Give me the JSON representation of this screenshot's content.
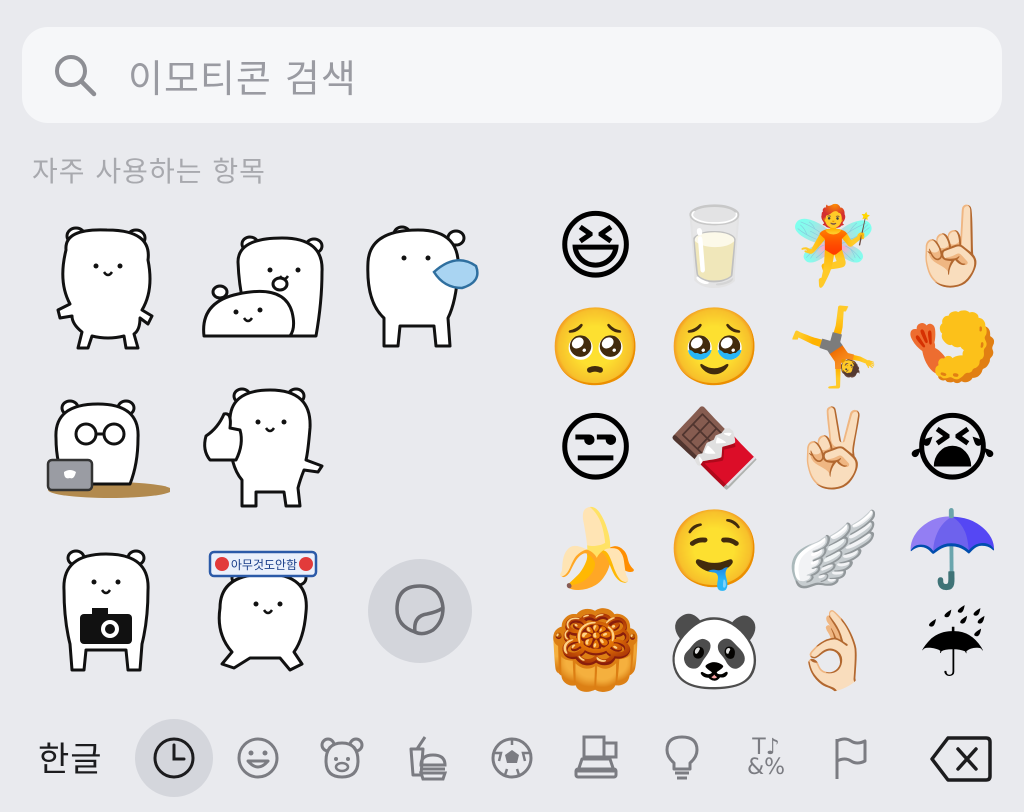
{
  "search": {
    "placeholder": "이모티콘 검색",
    "icon": "search-icon"
  },
  "section": {
    "title": "자주 사용하는 항목"
  },
  "stickers": [
    {
      "name": "bear-dancing"
    },
    {
      "name": "two-bears"
    },
    {
      "name": "bear-drinking-water"
    },
    {
      "name": "bear-with-glasses-laptop"
    },
    {
      "name": "bear-thumbs-up"
    },
    {
      "name": "bear-with-camera"
    },
    {
      "name": "bear-with-banner",
      "banner_text": "아무것도안함"
    }
  ],
  "sticker_toggle": {
    "icon": "sticker-peel-icon"
  },
  "emojis": [
    {
      "name": "grinning-squinting-face",
      "char": "😆"
    },
    {
      "name": "glass-of-milk",
      "char": "🥛"
    },
    {
      "name": "fairy",
      "char": "🧚"
    },
    {
      "name": "index-pointing-up",
      "char": "☝🏻"
    },
    {
      "name": "pleading-face",
      "char": "🥺"
    },
    {
      "name": "face-holding-back-tears",
      "char": "🥹"
    },
    {
      "name": "person-cartwheeling",
      "char": "🤸"
    },
    {
      "name": "fried-shrimp",
      "char": "🍤"
    },
    {
      "name": "unamused-face",
      "char": "😒"
    },
    {
      "name": "chocolate-bar",
      "char": "🍫"
    },
    {
      "name": "victory-hand",
      "char": "✌🏻"
    },
    {
      "name": "loudly-crying-face",
      "char": "😭"
    },
    {
      "name": "banana",
      "char": "🍌"
    },
    {
      "name": "drooling-face",
      "char": "🤤"
    },
    {
      "name": "wing",
      "char": "🪽"
    },
    {
      "name": "umbrella",
      "char": "☂️"
    },
    {
      "name": "moon-cake",
      "char": "🥮"
    },
    {
      "name": "panda",
      "char": "🐼"
    },
    {
      "name": "ok-hand",
      "char": "👌🏻"
    },
    {
      "name": "umbrella-with-rain-drops",
      "char": "☔"
    }
  ],
  "bottom_bar": {
    "language_key": "한글",
    "categories": [
      {
        "name": "recent-icon",
        "active": true
      },
      {
        "name": "smileys-icon",
        "active": false
      },
      {
        "name": "animals-icon",
        "active": false
      },
      {
        "name": "food-icon",
        "active": false
      },
      {
        "name": "activity-icon",
        "active": false
      },
      {
        "name": "travel-icon",
        "active": false
      },
      {
        "name": "objects-icon",
        "active": false
      },
      {
        "name": "symbols-icon",
        "active": false,
        "label_top": "T♪",
        "label_bottom": "&%"
      },
      {
        "name": "flags-icon",
        "active": false
      }
    ],
    "backspace": "backspace-icon"
  },
  "colors": {
    "background": "#e9eaee",
    "search_background": "#f6f7f9",
    "active_category": "#d4d6dc",
    "icon_gray": "#7b7c82"
  }
}
